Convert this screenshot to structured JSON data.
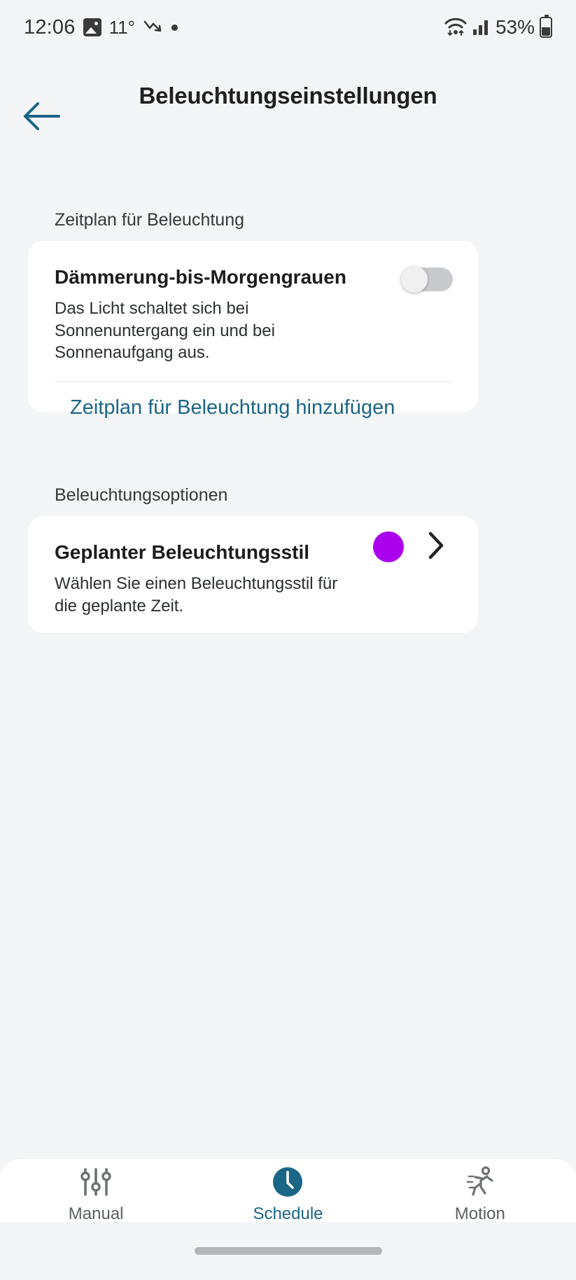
{
  "status_bar": {
    "time": "12:06",
    "temperature": "11°",
    "battery_percent": "53%",
    "icons": [
      "image-icon",
      "weather-trend-icon",
      "status-dot-icon",
      "wifi-icon",
      "cellular-signal-icon",
      "battery-icon"
    ]
  },
  "header": {
    "title": "Beleuchtungseinstellungen",
    "back_icon": "arrow-left-icon"
  },
  "sections": [
    {
      "label": "Zeitplan für Beleuchtung",
      "card": {
        "title": "Dämmerung-bis-Morgengrauen",
        "description": "Das Licht schaltet sich bei Sonnenuntergang ein und bei Sonnenaufgang aus.",
        "toggle_state": "off",
        "link": "Zeitplan für Beleuchtung hinzufügen"
      }
    },
    {
      "label": "Beleuchtungsoptionen",
      "card": {
        "title": "Geplanter Beleuchtungsstil",
        "description": "Wählen Sie einen Beleuchtungsstil für die geplante Zeit.",
        "swatch_color": "#AA00EE",
        "chevron_icon": "chevron-right-icon"
      }
    }
  ],
  "bottom_nav": {
    "items": [
      {
        "label": "Manual",
        "icon": "sliders-icon",
        "active": false
      },
      {
        "label": "Schedule",
        "icon": "clock-icon",
        "active": true
      },
      {
        "label": "Motion",
        "icon": "running-person-icon",
        "active": false
      }
    ]
  },
  "colors": {
    "accent_teal": "#1B6586",
    "background": "#F4F5F7",
    "card": "#FFFFFF",
    "swatch_purple": "#AA00EE",
    "inactive_nav": "#5D6165"
  }
}
